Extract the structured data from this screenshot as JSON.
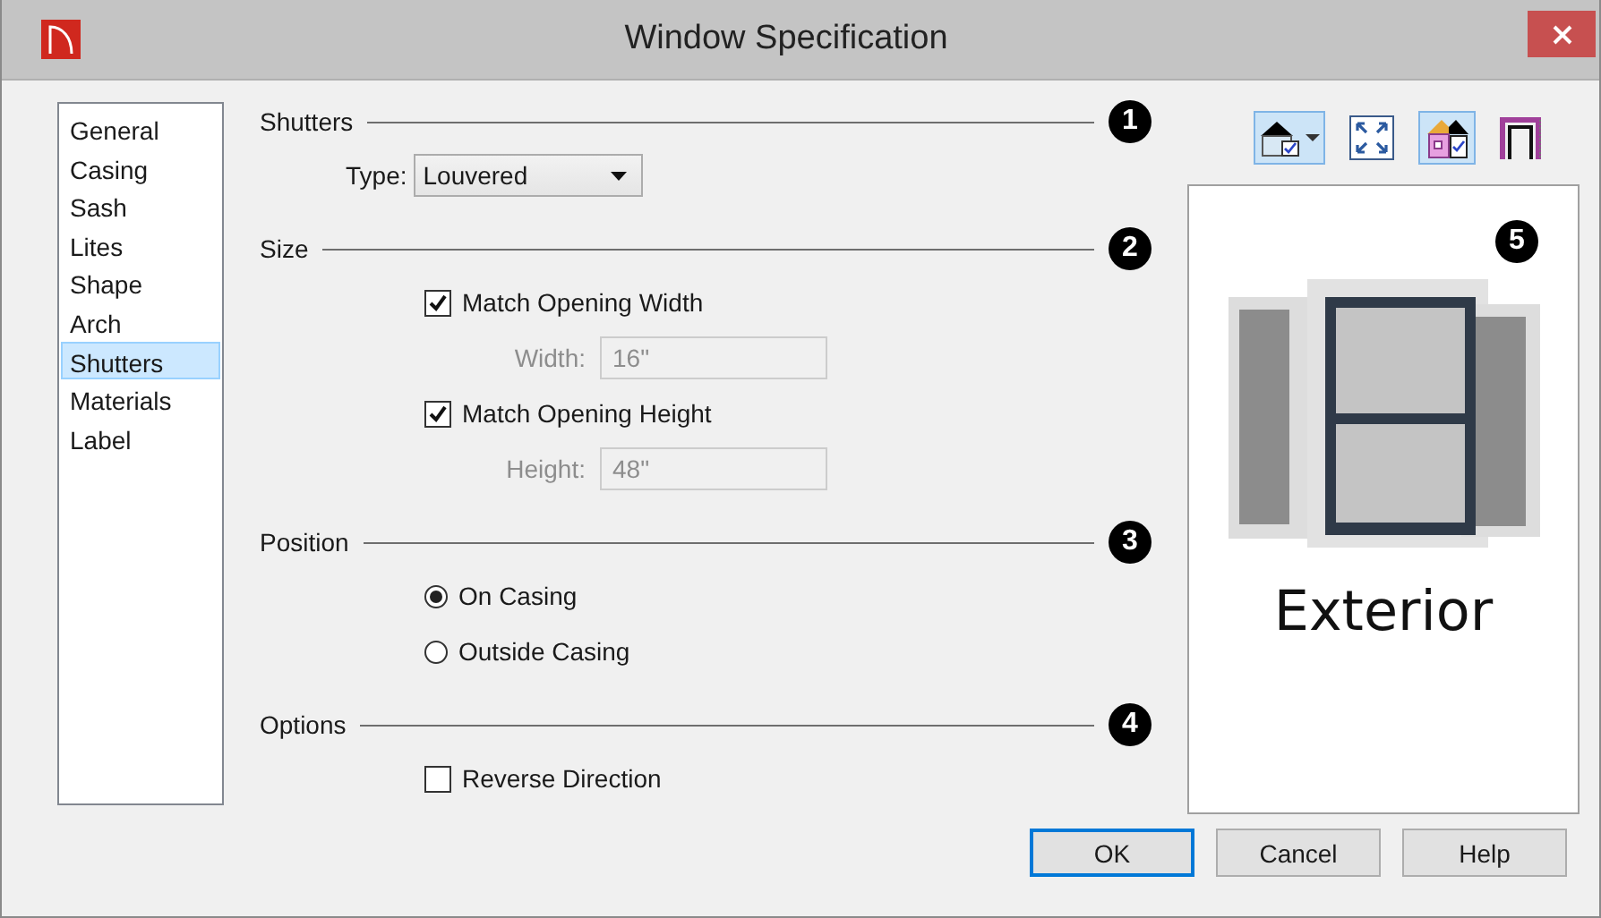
{
  "window": {
    "title": "Window Specification"
  },
  "sidebar": {
    "items": [
      {
        "label": "General",
        "selected": false
      },
      {
        "label": "Casing",
        "selected": false
      },
      {
        "label": "Sash",
        "selected": false
      },
      {
        "label": "Lites",
        "selected": false
      },
      {
        "label": "Shape",
        "selected": false
      },
      {
        "label": "Arch",
        "selected": false
      },
      {
        "label": "Shutters",
        "selected": true
      },
      {
        "label": "Materials",
        "selected": false
      },
      {
        "label": "Label",
        "selected": false
      }
    ]
  },
  "sections": [
    {
      "title": "Shutters",
      "callout": "1",
      "controls": [
        {
          "kind": "dropdown",
          "label": "Type:",
          "value": "Louvered"
        }
      ]
    },
    {
      "title": "Size",
      "callout": "2",
      "controls": [
        {
          "kind": "checkbox",
          "label": "Match Opening Width",
          "checked": true
        },
        {
          "kind": "field",
          "label": "Width:",
          "value": "16\"",
          "disabled": true
        },
        {
          "kind": "checkbox",
          "label": "Match Opening Height",
          "checked": true
        },
        {
          "kind": "field",
          "label": "Height:",
          "value": "48\"",
          "disabled": true
        }
      ]
    },
    {
      "title": "Position",
      "callout": "3",
      "controls": [
        {
          "kind": "radio",
          "label": "On Casing",
          "selected": true
        },
        {
          "kind": "radio",
          "label": "Outside Casing",
          "selected": false
        }
      ]
    },
    {
      "title": "Options",
      "callout": "4",
      "controls": [
        {
          "kind": "checkbox",
          "label": "Reverse Direction",
          "checked": false
        }
      ]
    }
  ],
  "preview": {
    "toolbar": [
      {
        "kind": "view",
        "selected": true
      },
      {
        "kind": "fit",
        "selected": false
      },
      {
        "kind": "color",
        "selected": true
      },
      {
        "kind": "frame",
        "selected": false
      }
    ],
    "callout": "5",
    "caption": "Exterior"
  },
  "buttons": [
    {
      "label": "OK",
      "default": true
    },
    {
      "label": "Cancel",
      "default": false
    },
    {
      "label": "Help",
      "default": false
    }
  ]
}
